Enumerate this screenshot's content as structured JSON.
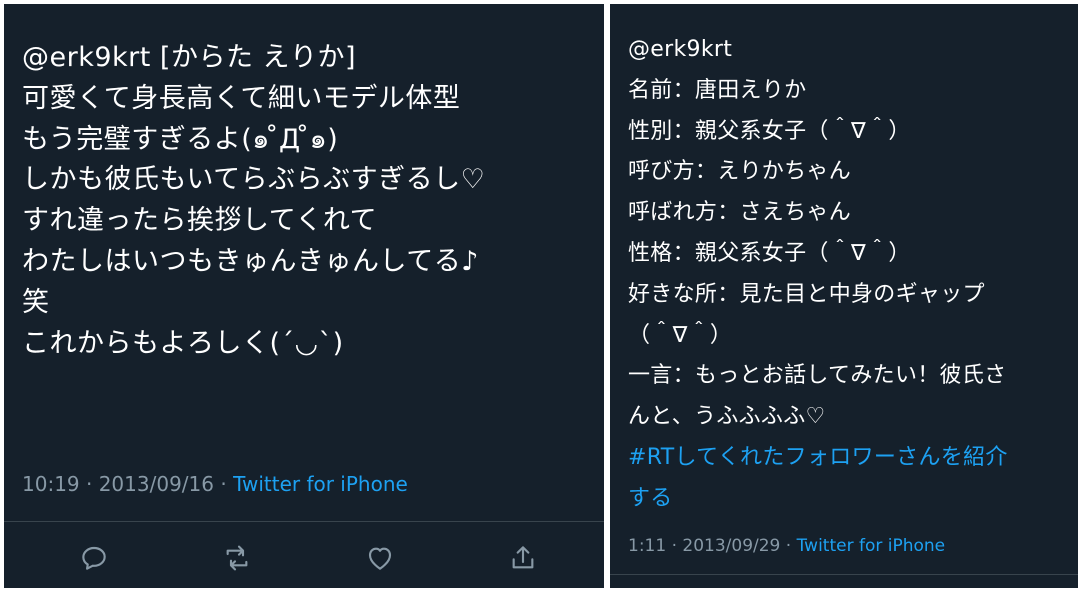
{
  "left_tweet": {
    "lines": [
      "@erk9krt [からた えりか]",
      "可愛くて身長高くて細いモデル体型",
      "もう完璧すぎるよ(๑ ̊Д ̊๑)",
      "しかも彼氏もいてらぶらぶすぎるし♡",
      "すれ違ったら挨拶してくれて",
      "わたしはいつもきゅんきゅんしてる♪",
      "笑",
      "これからもよろしく(´◡`)"
    ],
    "timestamp": "10:19 · 2013/09/16 · ",
    "source": "Twitter for iPhone",
    "actions": {
      "reply_icon": "reply-icon",
      "retweet_icon": "retweet-icon",
      "like_icon": "heart-icon",
      "share_icon": "share-icon"
    }
  },
  "right_tweet": {
    "lines": [
      "@erk9krt",
      "名前：唐田えりか",
      "性別：親父系女子（＾∇＾）",
      "呼び方：えりかちゃん",
      "呼ばれ方：さえちゃん",
      "性格：親父系女子（＾∇＾）",
      "好きな所：見た目と中身のギャップ",
      "（＾∇＾）",
      "一言：もっとお話してみたい！彼氏さ",
      "んと、うふふふふ♡"
    ],
    "hashtag_lines": [
      "#RTしてくれたフォロワーさんを紹介",
      "する"
    ],
    "timestamp": "1:11 · 2013/09/29 · ",
    "source": "Twitter for iPhone"
  },
  "colors": {
    "background": "#15202b",
    "text": "#ffffff",
    "muted": "#8899a6",
    "link": "#1da1f2",
    "divider": "#38444d"
  }
}
